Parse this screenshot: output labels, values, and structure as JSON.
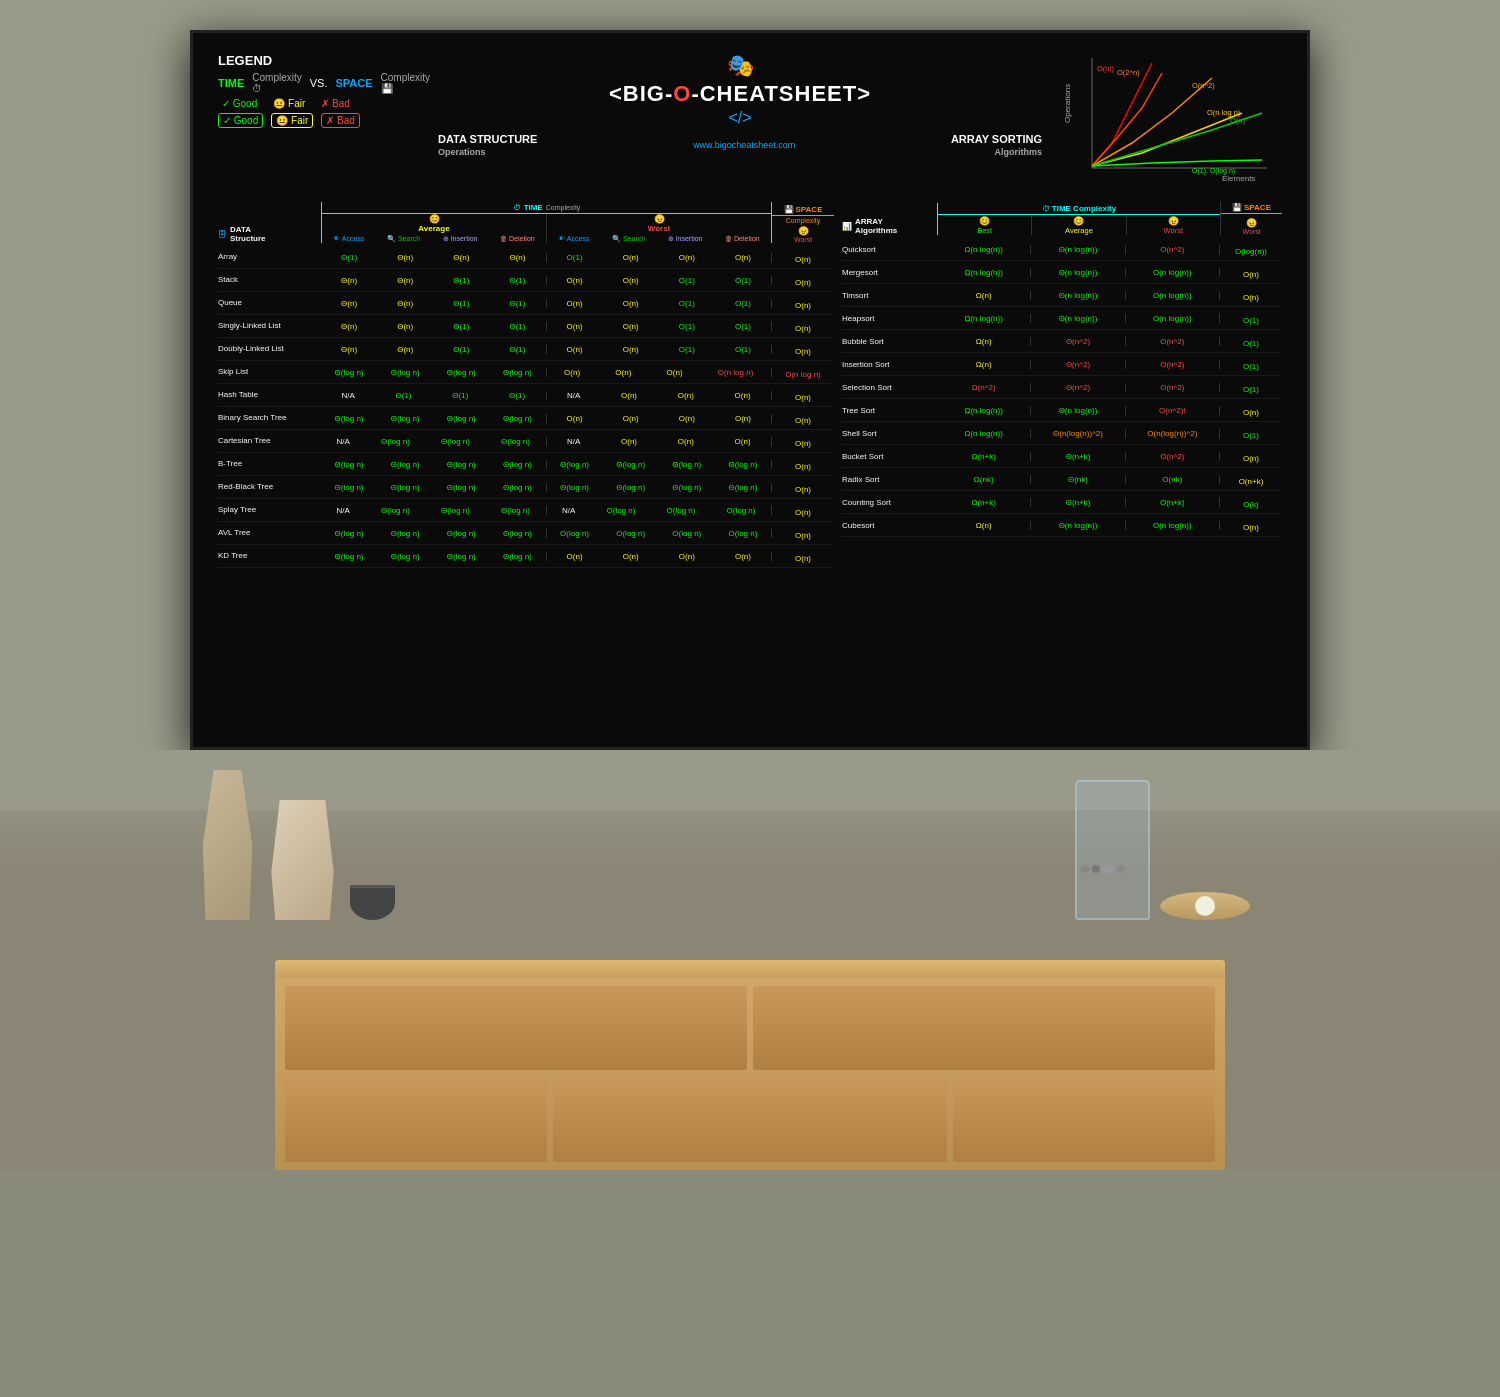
{
  "legend": {
    "title": "LEGEND",
    "time_label": "TIME",
    "time_suffix": "Complexity",
    "vs": "VS.",
    "space_label": "SPACE",
    "space_suffix": "Complexity",
    "ratings_time": [
      "Good",
      "Fair",
      "Bad"
    ],
    "ratings_space": [
      "Good",
      "Fair",
      "Bad"
    ]
  },
  "header": {
    "title_prefix": "<BIG-",
    "title_o": "O",
    "title_dash": "-",
    "title_suffix": "CHEATSHEET>",
    "subtitle": "</>",
    "website": "www.bigocheatsheet.com"
  },
  "sections": {
    "data_structure": {
      "title": "DATA STRUCTURE",
      "sub": "Operations"
    },
    "array_sorting": {
      "title": "ARRAY SORTING",
      "sub": "Algorithms"
    }
  },
  "graph": {
    "labels": [
      "O(n!)",
      "O(2^n)",
      "O(n^2)",
      "O(n log n)",
      "O(n)",
      "O(1), O(log n)"
    ],
    "y_axis": "Operations",
    "x_axis": "Elements"
  },
  "data_structures": [
    {
      "name": "Array",
      "avg_access": "Θ(1)",
      "avg_search": "Θ(n)",
      "avg_insert": "Θ(n)",
      "avg_delete": "Θ(n)",
      "worst_access": "O(1)",
      "worst_search": "O(n)",
      "worst_insert": "O(n)",
      "worst_delete": "O(n)",
      "space": "O(n)",
      "colors": {
        "avg_access": "green",
        "avg_search": "yellow",
        "avg_insert": "yellow",
        "avg_delete": "yellow",
        "worst_access": "green",
        "worst_search": "yellow",
        "worst_insert": "yellow",
        "worst_delete": "yellow",
        "space": "yellow"
      }
    },
    {
      "name": "Stack",
      "avg_access": "Θ(n)",
      "avg_search": "Θ(n)",
      "avg_insert": "Θ(1)",
      "avg_delete": "Θ(1)",
      "worst_access": "O(n)",
      "worst_search": "O(n)",
      "worst_insert": "O(1)",
      "worst_delete": "O(1)",
      "space": "O(n)",
      "colors": {
        "avg_access": "yellow",
        "avg_search": "yellow",
        "avg_insert": "green",
        "avg_delete": "green",
        "worst_access": "yellow",
        "worst_search": "yellow",
        "worst_insert": "green",
        "worst_delete": "green",
        "space": "yellow"
      }
    },
    {
      "name": "Queue",
      "avg_access": "Θ(n)",
      "avg_search": "Θ(n)",
      "avg_insert": "Θ(1)",
      "avg_delete": "Θ(1)",
      "worst_access": "O(n)",
      "worst_search": "O(n)",
      "worst_insert": "O(1)",
      "worst_delete": "O(1)",
      "space": "O(n)",
      "colors": {
        "avg_access": "yellow",
        "avg_search": "yellow",
        "avg_insert": "green",
        "avg_delete": "green",
        "worst_access": "yellow",
        "worst_search": "yellow",
        "worst_insert": "green",
        "worst_delete": "green",
        "space": "yellow"
      }
    },
    {
      "name": "Singly-Linked List",
      "avg_access": "Θ(n)",
      "avg_search": "Θ(n)",
      "avg_insert": "Θ(1)",
      "avg_delete": "Θ(1)",
      "worst_access": "O(n)",
      "worst_search": "O(n)",
      "worst_insert": "O(1)",
      "worst_delete": "O(1)",
      "space": "O(n)",
      "colors": {
        "avg_access": "yellow",
        "avg_search": "yellow",
        "avg_insert": "green",
        "avg_delete": "green",
        "worst_access": "yellow",
        "worst_search": "yellow",
        "worst_insert": "green",
        "worst_delete": "green",
        "space": "yellow"
      }
    },
    {
      "name": "Doubly-Linked List",
      "avg_access": "Θ(n)",
      "avg_search": "Θ(n)",
      "avg_insert": "Θ(1)",
      "avg_delete": "Θ(1)",
      "worst_access": "O(n)",
      "worst_search": "O(n)",
      "worst_insert": "O(1)",
      "worst_delete": "O(1)",
      "space": "O(n)",
      "colors": {
        "avg_access": "yellow",
        "avg_search": "yellow",
        "avg_insert": "green",
        "avg_delete": "green",
        "worst_access": "yellow",
        "worst_search": "yellow",
        "worst_insert": "green",
        "worst_delete": "green",
        "space": "yellow"
      }
    },
    {
      "name": "Skip List",
      "avg_access": "Θ(log n)",
      "avg_search": "Θ(log n)",
      "avg_insert": "Θ(log n)",
      "avg_delete": "Θ(log n)",
      "worst_access": "O(n)",
      "worst_search": "O(n)",
      "worst_insert": "O(n)",
      "worst_delete": "O(n log n)",
      "space": "O(n log n)",
      "colors": {
        "avg_access": "green",
        "avg_search": "green",
        "avg_insert": "green",
        "avg_delete": "green",
        "worst_access": "yellow",
        "worst_search": "yellow",
        "worst_insert": "yellow",
        "worst_delete": "red",
        "space": "red"
      }
    },
    {
      "name": "Hash Table",
      "avg_access": "N/A",
      "avg_search": "Θ(1)",
      "avg_insert": "Θ(1)",
      "avg_delete": "Θ(1)",
      "worst_access": "N/A",
      "worst_search": "O(n)",
      "worst_insert": "O(n)",
      "worst_delete": "O(n)",
      "space": "O(n)",
      "colors": {
        "avg_access": "white",
        "avg_search": "green",
        "avg_insert": "green",
        "avg_delete": "green",
        "worst_access": "white",
        "worst_search": "yellow",
        "worst_insert": "yellow",
        "worst_delete": "yellow",
        "space": "yellow"
      }
    },
    {
      "name": "Binary Search Tree",
      "avg_access": "Θ(log n)",
      "avg_search": "Θ(log n)",
      "avg_insert": "Θ(log n)",
      "avg_delete": "Θ(log n)",
      "worst_access": "O(n)",
      "worst_search": "O(n)",
      "worst_insert": "O(n)",
      "worst_delete": "O(n)",
      "space": "O(n)",
      "colors": {
        "avg_access": "green",
        "avg_search": "green",
        "avg_insert": "green",
        "avg_delete": "green",
        "worst_access": "yellow",
        "worst_search": "yellow",
        "worst_insert": "yellow",
        "worst_delete": "yellow",
        "space": "yellow"
      }
    },
    {
      "name": "Cartesian Tree",
      "avg_access": "N/A",
      "avg_search": "Θ(log n)",
      "avg_insert": "Θ(log n)",
      "avg_delete": "Θ(log n)",
      "worst_access": "N/A",
      "worst_search": "O(n)",
      "worst_insert": "O(n)",
      "worst_delete": "O(n)",
      "space": "O(n)",
      "colors": {
        "avg_access": "white",
        "avg_search": "green",
        "avg_insert": "green",
        "avg_delete": "green",
        "worst_access": "white",
        "worst_search": "yellow",
        "worst_insert": "yellow",
        "worst_delete": "yellow",
        "space": "yellow"
      }
    },
    {
      "name": "B-Tree",
      "avg_access": "Θ(log n)",
      "avg_search": "Θ(log n)",
      "avg_insert": "Θ(log n)",
      "avg_delete": "Θ(log n)",
      "worst_access": "Θ(log n)",
      "worst_search": "Θ(log n)",
      "worst_insert": "Θ(log n)",
      "worst_delete": "Θ(log n)",
      "space": "O(n)",
      "colors": {
        "avg_access": "green",
        "avg_search": "green",
        "avg_insert": "green",
        "avg_delete": "green",
        "worst_access": "green",
        "worst_search": "green",
        "worst_insert": "green",
        "worst_delete": "green",
        "space": "yellow"
      }
    },
    {
      "name": "Red-Black Tree",
      "avg_access": "Θ(log n)",
      "avg_search": "Θ(log n)",
      "avg_insert": "Θ(log n)",
      "avg_delete": "Θ(log n)",
      "worst_access": "Θ(log n)",
      "worst_search": "Θ(log n)",
      "worst_insert": "Θ(log n)",
      "worst_delete": "Θ(log n)",
      "space": "O(n)",
      "colors": {
        "avg_access": "green",
        "avg_search": "green",
        "avg_insert": "green",
        "avg_delete": "green",
        "worst_access": "green",
        "worst_search": "green",
        "worst_insert": "green",
        "worst_delete": "green",
        "space": "yellow"
      }
    },
    {
      "name": "Splay Tree",
      "avg_access": "N/A",
      "avg_search": "Θ(log n)",
      "avg_insert": "Θ(log n)",
      "avg_delete": "Θ(log n)",
      "worst_access": "N/A",
      "worst_search": "O(log n)",
      "worst_insert": "O(log n)",
      "worst_delete": "O(log n)",
      "space": "O(n)",
      "colors": {
        "avg_access": "white",
        "avg_search": "green",
        "avg_insert": "green",
        "avg_delete": "green",
        "worst_access": "white",
        "worst_search": "green",
        "worst_insert": "green",
        "worst_delete": "green",
        "space": "yellow"
      }
    },
    {
      "name": "AVL Tree",
      "avg_access": "Θ(log n)",
      "avg_search": "Θ(log n)",
      "avg_insert": "Θ(log n)",
      "avg_delete": "Θ(log n)",
      "worst_access": "O(log n)",
      "worst_search": "O(log n)",
      "worst_insert": "O(log n)",
      "worst_delete": "O(log n)",
      "space": "O(n)",
      "colors": {
        "avg_access": "green",
        "avg_search": "green",
        "avg_insert": "green",
        "avg_delete": "green",
        "worst_access": "green",
        "worst_search": "green",
        "worst_insert": "green",
        "worst_delete": "green",
        "space": "yellow"
      }
    },
    {
      "name": "KD Tree",
      "avg_access": "Θ(log n)",
      "avg_search": "Θ(log n)",
      "avg_insert": "Θ(log n)",
      "avg_delete": "Θ(log n)",
      "worst_access": "O(n)",
      "worst_search": "O(n)",
      "worst_insert": "O(n)",
      "worst_delete": "O(n)",
      "space": "O(n)",
      "colors": {
        "avg_access": "green",
        "avg_search": "green",
        "avg_insert": "green",
        "avg_delete": "green",
        "worst_access": "yellow",
        "worst_search": "yellow",
        "worst_insert": "yellow",
        "worst_delete": "yellow",
        "space": "yellow"
      }
    }
  ],
  "sorting_algorithms": [
    {
      "name": "Quicksort",
      "best": "Ω(n log(n))",
      "avg": "Θ(n log(n))",
      "worst": "O(n^2)",
      "space": "O(log(n))",
      "colors": {
        "best": "green",
        "avg": "green",
        "worst": "red",
        "space": "green"
      }
    },
    {
      "name": "Mergesort",
      "best": "Ω(n log(n))",
      "avg": "Θ(n log(n))",
      "worst": "O(n log(n))",
      "space": "O(n)",
      "colors": {
        "best": "green",
        "avg": "green",
        "worst": "green",
        "space": "yellow"
      }
    },
    {
      "name": "Timsort",
      "best": "Ω(n)",
      "avg": "Θ(n log(n))",
      "worst": "O(n log(n))",
      "space": "O(n)",
      "colors": {
        "best": "yellow",
        "avg": "green",
        "worst": "green",
        "space": "yellow"
      }
    },
    {
      "name": "Heapsort",
      "best": "Ω(n log(n))",
      "avg": "Θ(n log(n))",
      "worst": "O(n log(n))",
      "space": "O(1)",
      "colors": {
        "best": "green",
        "avg": "green",
        "worst": "green",
        "space": "green"
      }
    },
    {
      "name": "Bubble Sort",
      "best": "Ω(n)",
      "avg": "Θ(n^2)",
      "worst": "O(n^2)",
      "space": "O(1)",
      "colors": {
        "best": "yellow",
        "avg": "red",
        "worst": "red",
        "space": "green"
      }
    },
    {
      "name": "Insertion Sort",
      "best": "Ω(n)",
      "avg": "Θ(n^2)",
      "worst": "O(n^2)",
      "space": "O(1)",
      "colors": {
        "best": "yellow",
        "avg": "red",
        "worst": "red",
        "space": "green"
      }
    },
    {
      "name": "Selection Sort",
      "best": "Ω(n^2)",
      "avg": "Θ(n^2)",
      "worst": "O(n^2)",
      "space": "O(1)",
      "colors": {
        "best": "red",
        "avg": "red",
        "worst": "red",
        "space": "green"
      }
    },
    {
      "name": "Tree Sort",
      "best": "Ω(n log(n))",
      "avg": "Θ(n log(n))",
      "worst": "O(n^2)t",
      "space": "O(n)",
      "colors": {
        "best": "green",
        "avg": "green",
        "worst": "red",
        "space": "yellow"
      }
    },
    {
      "name": "Shell Sort",
      "best": "Ω(n log(n))",
      "avg": "Θ(n(log(n))^2)",
      "worst": "O(n(log(n))^2)",
      "space": "O(1)",
      "colors": {
        "best": "green",
        "avg": "orange",
        "worst": "orange",
        "space": "green"
      }
    },
    {
      "name": "Bucket Sort",
      "best": "Ω(n+k)",
      "avg": "Θ(n+k)",
      "worst": "O(n^2)",
      "space": "O(n)",
      "colors": {
        "best": "green",
        "avg": "green",
        "worst": "red",
        "space": "yellow"
      }
    },
    {
      "name": "Radix Sort",
      "best": "Ω(nk)",
      "avg": "Θ(nk)",
      "worst": "O(nk)",
      "space": "O(n+k)",
      "colors": {
        "best": "green",
        "avg": "green",
        "worst": "green",
        "space": "yellow"
      }
    },
    {
      "name": "Counting Sort",
      "best": "Ω(n+k)",
      "avg": "Θ(n+k)",
      "worst": "O(n+k)",
      "space": "O(k)",
      "colors": {
        "best": "green",
        "avg": "green",
        "worst": "green",
        "space": "green"
      }
    },
    {
      "name": "Cubesort",
      "best": "Ω(n)",
      "avg": "Θ(n log(n))",
      "worst": "O(n log(n))",
      "space": "O(n)",
      "colors": {
        "best": "yellow",
        "avg": "green",
        "worst": "green",
        "space": "yellow"
      }
    }
  ]
}
